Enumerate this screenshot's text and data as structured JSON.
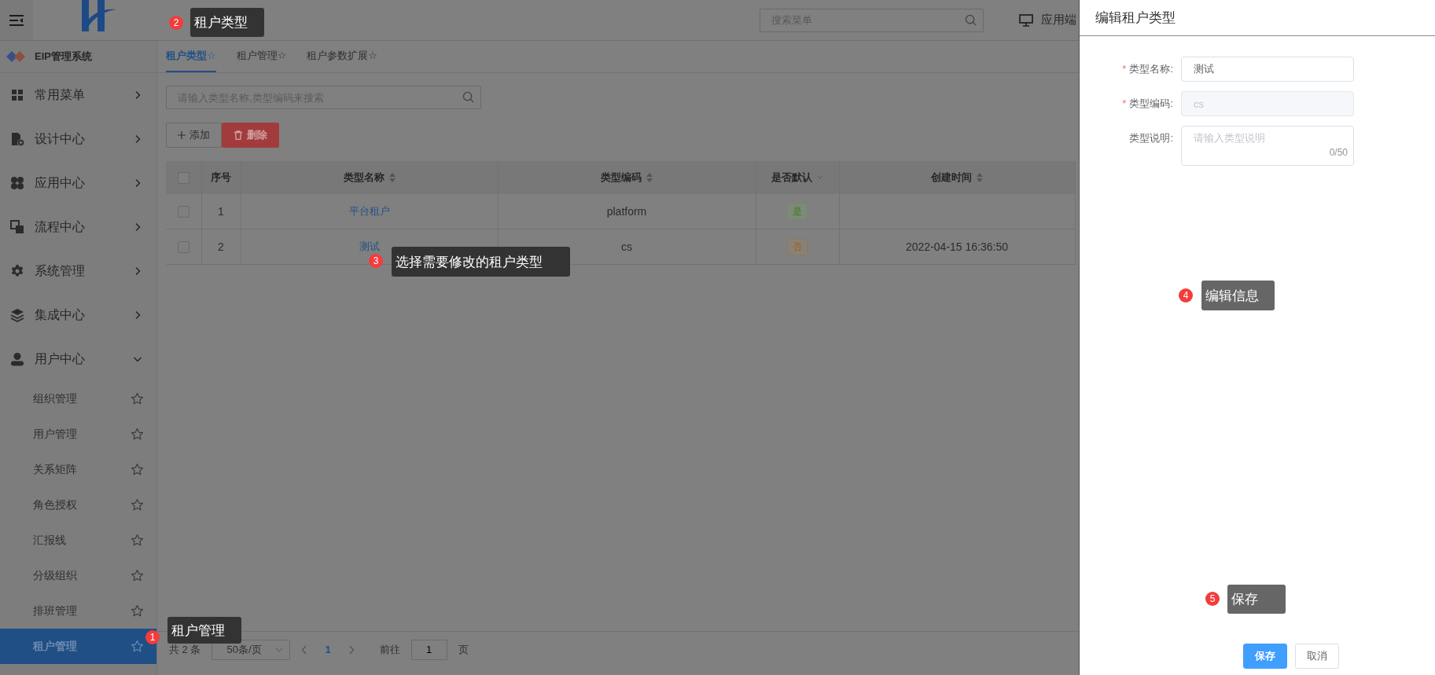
{
  "header": {
    "search": {
      "placeholder": "搜索菜单"
    },
    "app_switch": "应用端"
  },
  "sidebar": {
    "brand": "EIP管理系统",
    "items": [
      {
        "label": "常用菜单",
        "expanded": false
      },
      {
        "label": "设计中心",
        "expanded": false
      },
      {
        "label": "应用中心",
        "expanded": false
      },
      {
        "label": "流程中心",
        "expanded": false
      },
      {
        "label": "系统管理",
        "expanded": false
      },
      {
        "label": "集成中心",
        "expanded": false
      },
      {
        "label": "用户中心",
        "expanded": true,
        "children": [
          {
            "label": "组织管理",
            "selected": false
          },
          {
            "label": "用户管理",
            "selected": false
          },
          {
            "label": "关系矩阵",
            "selected": false
          },
          {
            "label": "角色授权",
            "selected": false
          },
          {
            "label": "汇报线",
            "selected": false
          },
          {
            "label": "分级组织",
            "selected": false
          },
          {
            "label": "排班管理",
            "selected": false
          },
          {
            "label": "租户管理",
            "selected": true
          }
        ]
      }
    ]
  },
  "tabs": [
    {
      "label": "租户类型☆",
      "selected": true
    },
    {
      "label": "租户管理☆",
      "selected": false
    },
    {
      "label": "租户参数扩展☆",
      "selected": false
    }
  ],
  "toolbar": {
    "search": {
      "placeholder": "请输入类型名称,类型编码来搜索"
    },
    "buttons": [
      {
        "label": "添加",
        "kind": "add"
      },
      {
        "label": "删除",
        "kind": "delete"
      }
    ]
  },
  "table": {
    "all_checked": false,
    "columns": [
      {
        "label": "序号",
        "kind": "plain"
      },
      {
        "label": "类型名称",
        "kind": "sort"
      },
      {
        "label": "类型编码",
        "kind": "sort"
      },
      {
        "label": "是否默认",
        "kind": "filter"
      },
      {
        "label": "创建时间",
        "kind": "sort"
      }
    ],
    "rows": [
      {
        "checked": false,
        "index": "1",
        "name": "平台租户",
        "code": "platform",
        "default": "是",
        "is_default": true
      },
      {
        "checked": false,
        "index": "2",
        "name": "测试",
        "code": "cs",
        "default": "否",
        "is_default": false,
        "created": "2022-04-15 16:36:50"
      }
    ]
  },
  "pagination": {
    "total": "共 2 条",
    "page_size": "50条/页",
    "pages": [
      {
        "label": "1",
        "selected": true
      }
    ],
    "goto_label": "前往",
    "goto_value": "1",
    "goto_suffix": "页"
  },
  "drawer": {
    "title": "编辑租户类型",
    "fields": [
      {
        "kind": "input",
        "marker": "*",
        "label": "类型名称:",
        "value": "测试",
        "disabled": false
      },
      {
        "kind": "input",
        "marker": "*",
        "label": "类型编码:",
        "value": "cs",
        "disabled": true
      },
      {
        "kind": "textarea",
        "label": "类型说明:",
        "placeholder": "请输入类型说明",
        "counter": "0/50"
      }
    ],
    "buttons": [
      {
        "label": "保存",
        "kind": "primary"
      },
      {
        "label": "取消",
        "kind": "default"
      }
    ]
  },
  "annotations": [
    {
      "number": "2",
      "text": "租户类型"
    },
    {
      "number": "3",
      "text": "选择需要修改的租户类型"
    },
    {
      "number": "4",
      "text": "编辑信息"
    },
    {
      "number": "5",
      "text": "保存"
    },
    {
      "number": "1",
      "text": "租户管理"
    }
  ]
}
